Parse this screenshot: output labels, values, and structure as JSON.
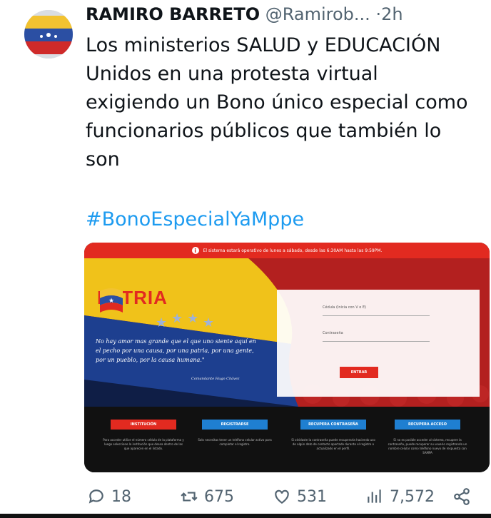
{
  "tweet": {
    "author_name": "RAMIRO BARRETO",
    "handle": "@Ramirob...",
    "dot": "·",
    "time": "2h",
    "text_lines": [
      "Los ministerios SALUD  y EDUCACIÓN",
      "Unidos en una protesta virtual",
      "exigiendo un Bono único especial como",
      "funcionarios públicos que también lo",
      "son"
    ],
    "hashtag": "#BonoEspecialYaMppe"
  },
  "media": {
    "notice": "El sistema estará operativo de lunes a sábado, desde las 6:30AM hasta las 9:59PM.",
    "brand": "PATRIA",
    "quote": "No hay amor mas grande que el que uno siente aquí en el pecho por una causa, por una patria, por una gente, por un pueblo, por la causa humana.\"",
    "quote_author": "Comandante Hugo Chávez",
    "login": {
      "cedula_label": "Cédula (Inicia con V o E)",
      "password_label": "Contraseña",
      "enter_button": "ENTRAR"
    },
    "footer_buttons": [
      "INSTITUCIÓN",
      "REGISTRARSE",
      "RECUPERA CONTRASEÑA",
      "RECUPERA ACCESO"
    ],
    "footer_texts": [
      "Para acceder utilice el número cédula de la plataforma y luego seleccione la institución que desea dentro de las que aparecen en el listado.",
      "Solo necesitas tener un teléfono celular activo para completar el registro.",
      "Si olvidaste la contraseña puede recuperarla haciendo uso de algún dato de contacto aportado durante el registro o actualizado en el perfil.",
      "Si no es posible acceder al sistema, recupere la contraseña, puede recuperar su usuario registrando un nombre celular como teléfono nuevo de respuesta con SAMPA"
    ],
    "footer_button_colors": [
      "#e22a20",
      "#1f7fd1",
      "#1f7fd1",
      "#1f7fd1"
    ]
  },
  "actions": {
    "replies": "18",
    "retweets": "675",
    "likes": "531",
    "views": "7,572"
  }
}
